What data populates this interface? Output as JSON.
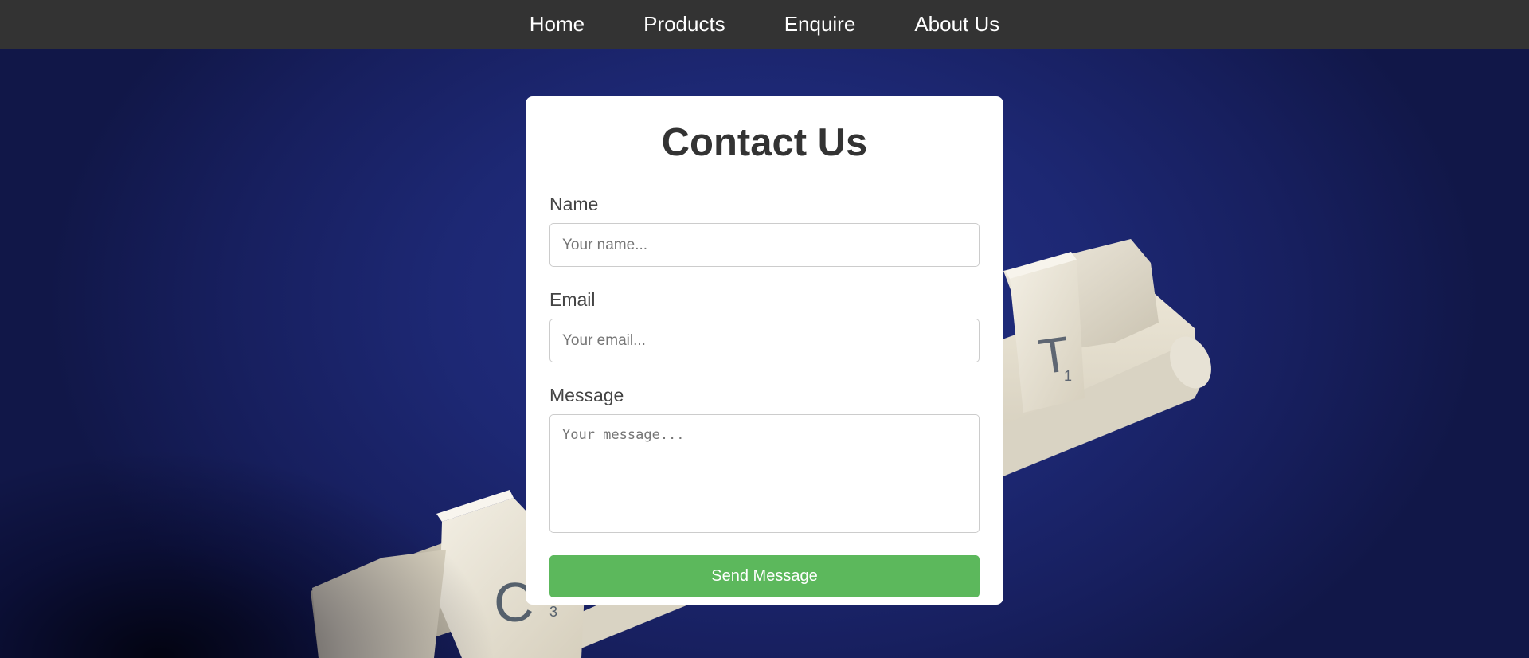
{
  "nav": {
    "items": [
      {
        "label": "Home"
      },
      {
        "label": "Products"
      },
      {
        "label": "Enquire"
      },
      {
        "label": "About Us"
      }
    ]
  },
  "contact_form": {
    "title": "Contact Us",
    "name_label": "Name",
    "name_placeholder": "Your name...",
    "name_value": "",
    "email_label": "Email",
    "email_placeholder": "Your email...",
    "email_value": "",
    "message_label": "Message",
    "message_placeholder": "Your message...",
    "message_value": "",
    "submit_label": "Send Message"
  },
  "background": {
    "tiles": [
      {
        "letter": "T",
        "score": "1"
      },
      {
        "letter": "C",
        "score": "3"
      }
    ]
  },
  "colors": {
    "navbar": "#333333",
    "background_blue": "#1d2874",
    "submit_button": "#5cb85c",
    "card": "#ffffff"
  }
}
